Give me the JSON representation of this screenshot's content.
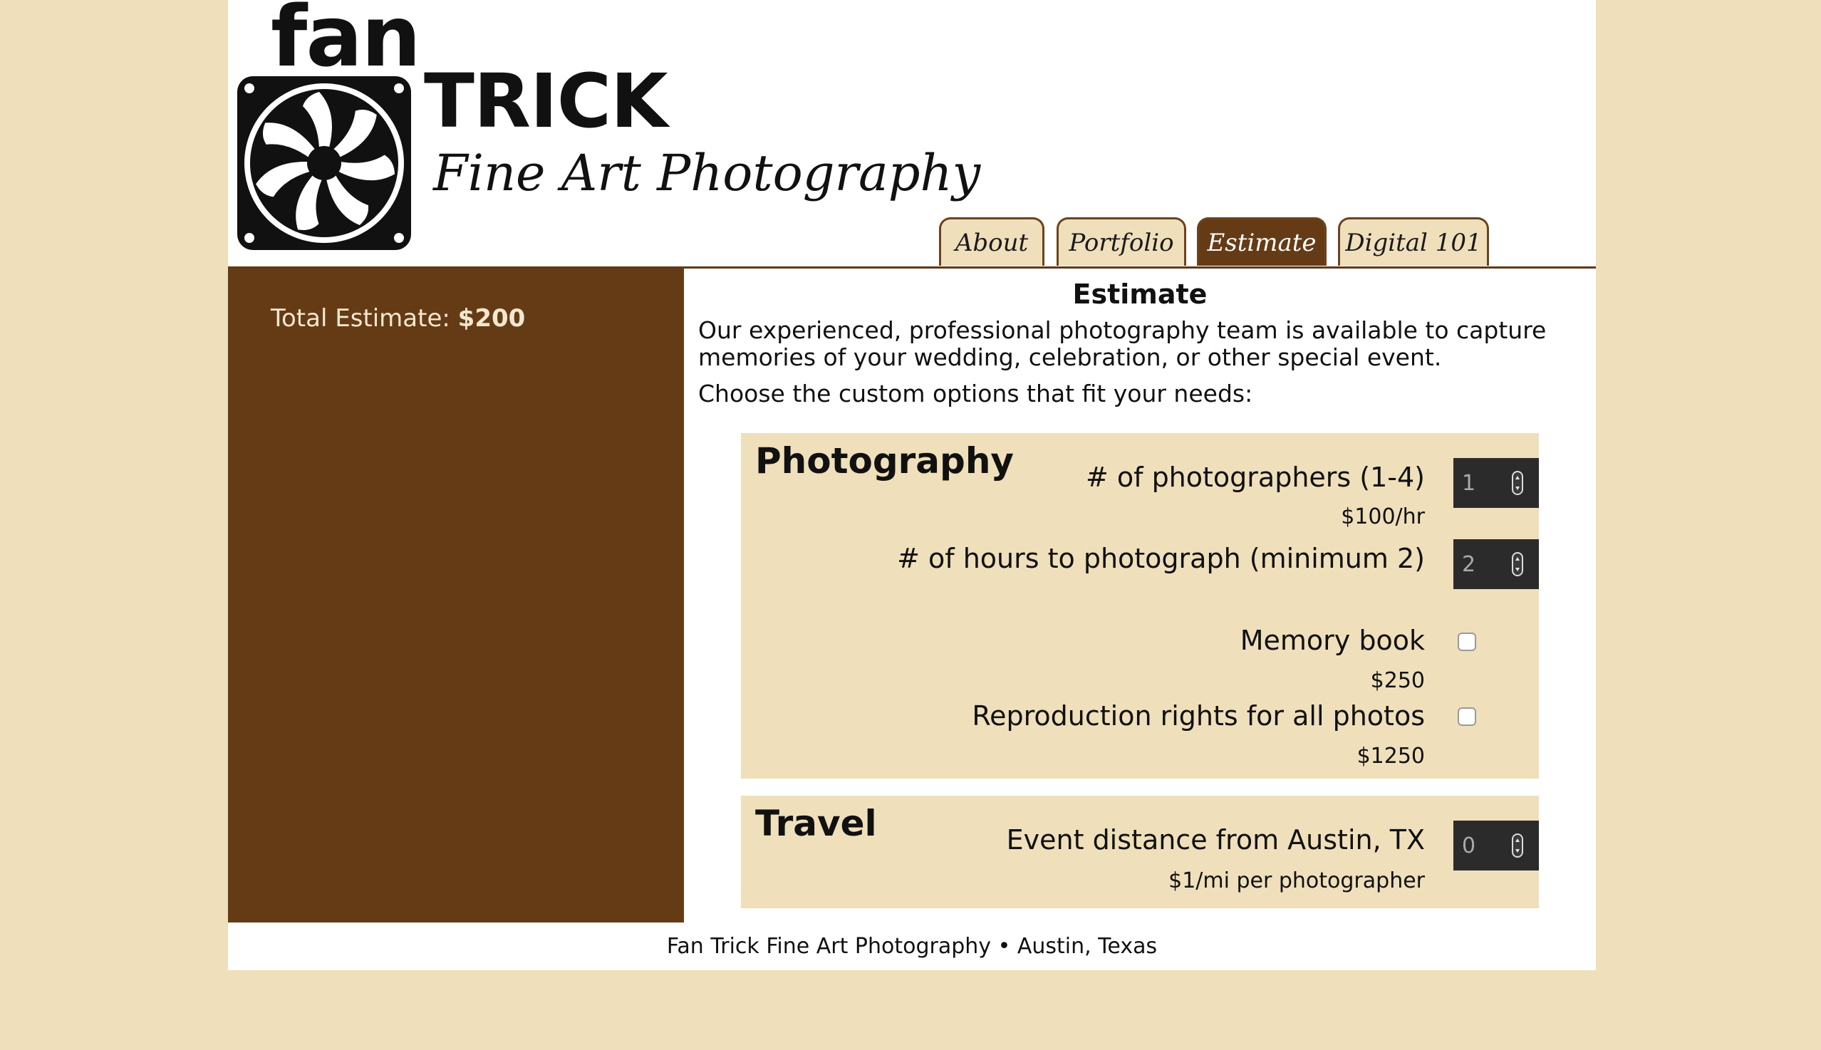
{
  "brand": {
    "line1": "fan",
    "line2": "TRICK",
    "line3": "Fine Art Photography"
  },
  "nav": {
    "tabs": [
      {
        "label": "About",
        "active": false
      },
      {
        "label": "Portfolio",
        "active": false
      },
      {
        "label": "Estimate",
        "active": true
      },
      {
        "label": "Digital 101",
        "active": false
      }
    ]
  },
  "sidebar": {
    "total_label": "Total Estimate:",
    "total_value": "$200"
  },
  "main": {
    "title": "Estimate",
    "intro": "Our experienced, professional photography team is available to capture memories of your wedding, celebration, or other special event.",
    "choose": "Choose the custom options that fit your needs:",
    "photography": {
      "title": "Photography",
      "photographers_label": "# of photographers (1-4)",
      "photographers_value": "1",
      "rate": "$100/hr",
      "hours_label": "# of hours to photograph (minimum 2)",
      "hours_value": "2",
      "memory_book_label": "Memory book",
      "memory_book_price": "$250",
      "memory_book_checked": false,
      "rights_label": "Reproduction rights for all photos",
      "rights_price": "$1250",
      "rights_checked": false
    },
    "travel": {
      "title": "Travel",
      "distance_label": "Event distance from Austin, TX",
      "distance_value": "0",
      "rate": "$1/mi per photographer"
    }
  },
  "footer": {
    "text": "Fan Trick Fine Art Photography • Austin, Texas"
  },
  "colors": {
    "background": "#efdfbb",
    "brown": "#653b16",
    "stepper": "#2b2b2b"
  },
  "icons": {
    "logo": "fan-icon",
    "stepper": "spinner-arrows-icon"
  }
}
